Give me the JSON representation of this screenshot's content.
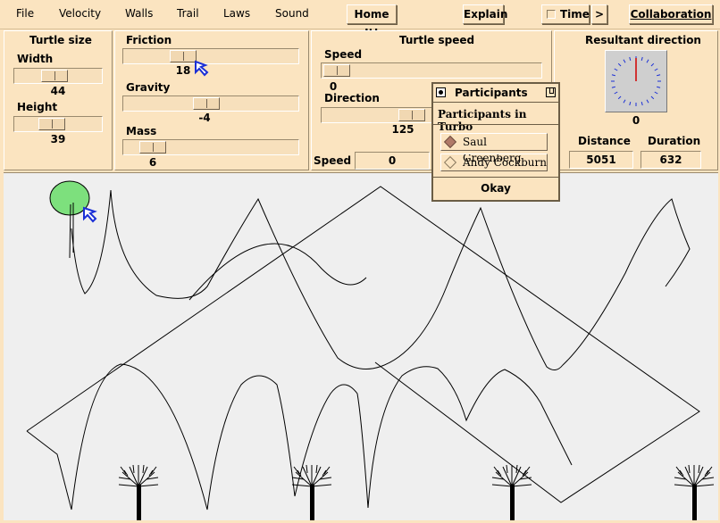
{
  "menu": [
    "File",
    "Velocity",
    "Walls",
    "Trail",
    "Laws",
    "Sound"
  ],
  "toolbar": {
    "home_label": "Home It!",
    "explain_label": "Explain",
    "time_label": "Time",
    "time_arrow": ">",
    "collaboration_label": "Collaboration"
  },
  "turtle_size": {
    "title": "Turtle size",
    "width_label": "Width",
    "width_value": "44",
    "height_label": "Height",
    "height_value": "39"
  },
  "physics": {
    "friction_label": "Friction",
    "friction_value": "18",
    "gravity_label": "Gravity",
    "gravity_value": "-4",
    "mass_label": "Mass",
    "mass_value": "6"
  },
  "turtle_speed": {
    "title": "Turtle speed",
    "speed_label": "Speed",
    "speed_value": "0",
    "direction_label": "Direction",
    "direction_value": "125",
    "bottom_speed_label": "Speed",
    "bottom_speed_value": "0"
  },
  "resultant": {
    "title": "Resultant direction",
    "value": "0",
    "distance_label": "Distance",
    "distance_value": "5051",
    "duration_label": "Duration",
    "duration_value": "632"
  },
  "participants_dialog": {
    "title": "Participants",
    "heading": "Participants in Turbo",
    "participants": [
      "Saul Greenberg",
      "Andy Cockburn"
    ],
    "ok_label": "Okay"
  },
  "colors": {
    "background": "#fbe4c0",
    "canvas": "#efefef",
    "turtle": "#7de07d",
    "cursor": "#1a2fd6"
  }
}
